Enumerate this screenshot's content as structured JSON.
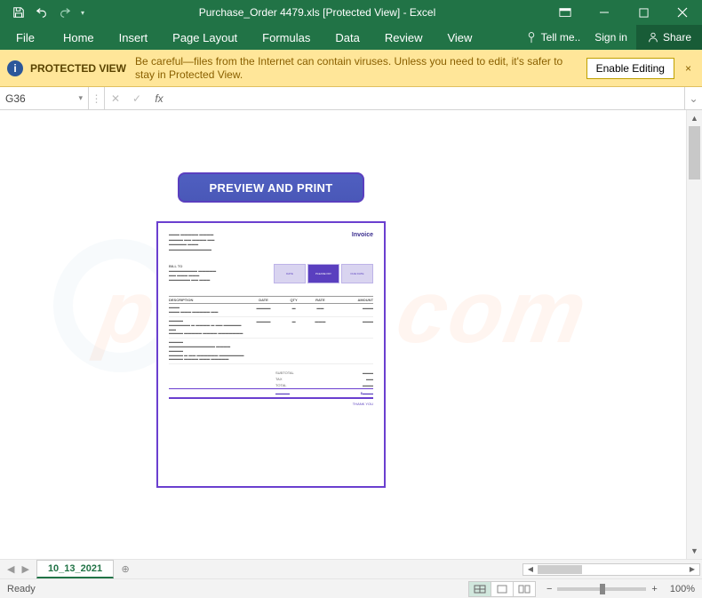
{
  "titlebar": {
    "filename": "Purchase_Order 4479.xls  [Protected View] - Excel"
  },
  "ribbon": {
    "tabs": [
      "File",
      "Home",
      "Insert",
      "Page Layout",
      "Formulas",
      "Data",
      "Review",
      "View"
    ],
    "tellme": "Tell me..",
    "signin": "Sign in",
    "share": "Share"
  },
  "protected_view": {
    "title": "PROTECTED VIEW",
    "message": "Be careful—files from the Internet can contain viruses. Unless you need to edit, it's safer to stay in Protected View.",
    "button": "Enable Editing"
  },
  "formula_bar": {
    "namebox": "G36",
    "fx": "fx",
    "value": ""
  },
  "document": {
    "preview_button": "PREVIEW AND PRINT",
    "invoice": {
      "title": "Invoice",
      "boxes": [
        "DATE",
        "PLEASE PAY",
        "DUE DATE"
      ],
      "columns": [
        "DESCRIPTION",
        "DATE",
        "QTY",
        "RATE",
        "AMOUNT"
      ],
      "totals": [
        "SUBTOTAL",
        "TAX",
        "TOTAL"
      ],
      "thanks": "THANK YOU"
    }
  },
  "sheet_tabs": {
    "active": "10_13_2021"
  },
  "statusbar": {
    "ready": "Ready",
    "zoom": "100%"
  },
  "watermark": "pcrisk.com"
}
